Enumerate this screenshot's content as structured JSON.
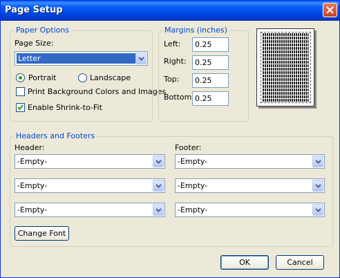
{
  "window": {
    "title": "Page Setup"
  },
  "paper_options": {
    "group_label": "Paper Options",
    "page_size_label": "Page Size:",
    "page_size_value": "Letter",
    "portrait_label": "Portrait",
    "landscape_label": "Landscape",
    "orientation": "portrait",
    "print_background_label": "Print Background Colors and Images",
    "print_background_checked": false,
    "shrink_to_fit_label": "Enable Shrink-to-Fit",
    "shrink_to_fit_checked": true
  },
  "margins": {
    "group_label": "Margins (inches)",
    "left_label": "Left:",
    "left_value": "0.25",
    "right_label": "Right:",
    "right_value": "0.25",
    "top_label": "Top:",
    "top_value": "0.25",
    "bottom_label": "Bottom:",
    "bottom_value": "0.25"
  },
  "headers_footers": {
    "group_label": "Headers and Footers",
    "header_label": "Header:",
    "footer_label": "Footer:",
    "header_values": [
      "-Empty-",
      "-Empty-",
      "-Empty-"
    ],
    "footer_values": [
      "-Empty-",
      "-Empty-",
      "-Empty-"
    ],
    "change_font_label": "Change Font"
  },
  "buttons": {
    "ok": "OK",
    "cancel": "Cancel"
  }
}
